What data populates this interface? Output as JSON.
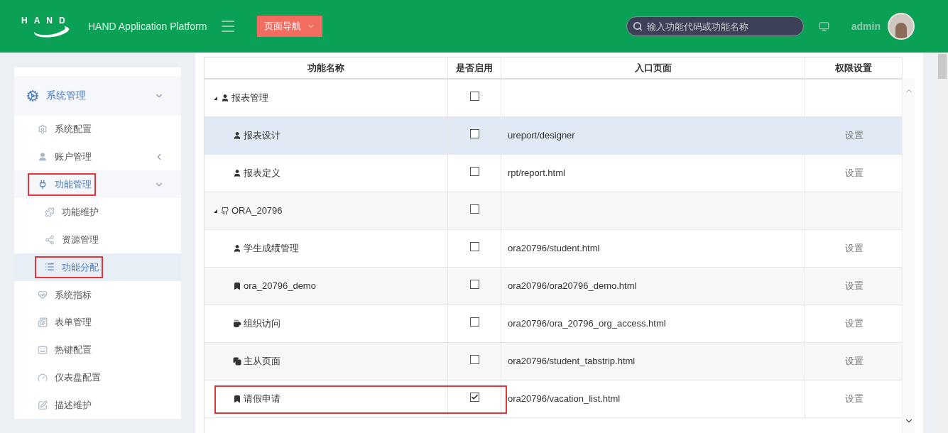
{
  "header": {
    "logo_text": "HAND",
    "title": "HAND Application Platform",
    "nav_button": "页面导航",
    "search": {
      "placeholder": "输入功能代码或功能名称"
    },
    "user": "admin"
  },
  "sidebar": {
    "items": [
      {
        "label": "系统管理",
        "expanded": true,
        "annotated": false,
        "selected": false,
        "children": [
          {
            "label": "系统配置",
            "annotated": false,
            "selected": false
          },
          {
            "label": "账户管理",
            "annotated": false,
            "selected": false,
            "expanded": false
          },
          {
            "label": "功能管理",
            "expanded": true,
            "annotated": true,
            "selected": false,
            "children": [
              {
                "label": "功能维护",
                "annotated": false,
                "selected": false
              },
              {
                "label": "资源管理",
                "annotated": false,
                "selected": false
              },
              {
                "label": "功能分配",
                "annotated": true,
                "selected": true
              }
            ]
          },
          {
            "label": "系统指标",
            "annotated": false,
            "selected": false
          },
          {
            "label": "表单管理",
            "annotated": false,
            "selected": false
          },
          {
            "label": "热键配置",
            "annotated": false,
            "selected": false
          },
          {
            "label": "仪表盘配置",
            "annotated": false,
            "selected": false
          },
          {
            "label": "描述维护",
            "annotated": false,
            "selected": false
          }
        ]
      }
    ]
  },
  "table": {
    "columns": [
      "功能名称",
      "是否启用",
      "入口页面",
      "权限设置"
    ],
    "rows": [
      {
        "name": "报表管理",
        "checked": false,
        "highlighted": false,
        "annotated": false,
        "expanded": true,
        "children": [
          {
            "name": "报表设计",
            "checked": false,
            "highlighted": true,
            "annotated": false,
            "entry": "ureport/designer",
            "action": "设置"
          },
          {
            "name": "报表定义",
            "checked": false,
            "highlighted": false,
            "annotated": false,
            "entry": "rpt/report.html",
            "action": "设置"
          }
        ]
      },
      {
        "name": "ORA_20796",
        "checked": false,
        "highlighted": false,
        "annotated": false,
        "expanded": true,
        "children": [
          {
            "name": "学生成绩管理",
            "checked": false,
            "highlighted": false,
            "annotated": false,
            "entry": "ora20796/student.html",
            "action": "设置"
          },
          {
            "name": "ora_20796_demo",
            "checked": false,
            "highlighted": false,
            "annotated": false,
            "entry": "ora20796/ora20796_demo.html",
            "action": "设置"
          },
          {
            "name": "组织访问",
            "checked": false,
            "highlighted": false,
            "annotated": false,
            "entry": "ora20796/ora_20796_org_access.html",
            "action": "设置"
          },
          {
            "name": "主从页面",
            "checked": false,
            "highlighted": false,
            "annotated": false,
            "entry": "ora20796/student_tabstrip.html",
            "action": "设置"
          },
          {
            "name": "请假申请",
            "checked": true,
            "highlighted": false,
            "annotated": true,
            "entry": "ora20796/vacation_list.html",
            "action": "设置"
          }
        ]
      }
    ]
  }
}
